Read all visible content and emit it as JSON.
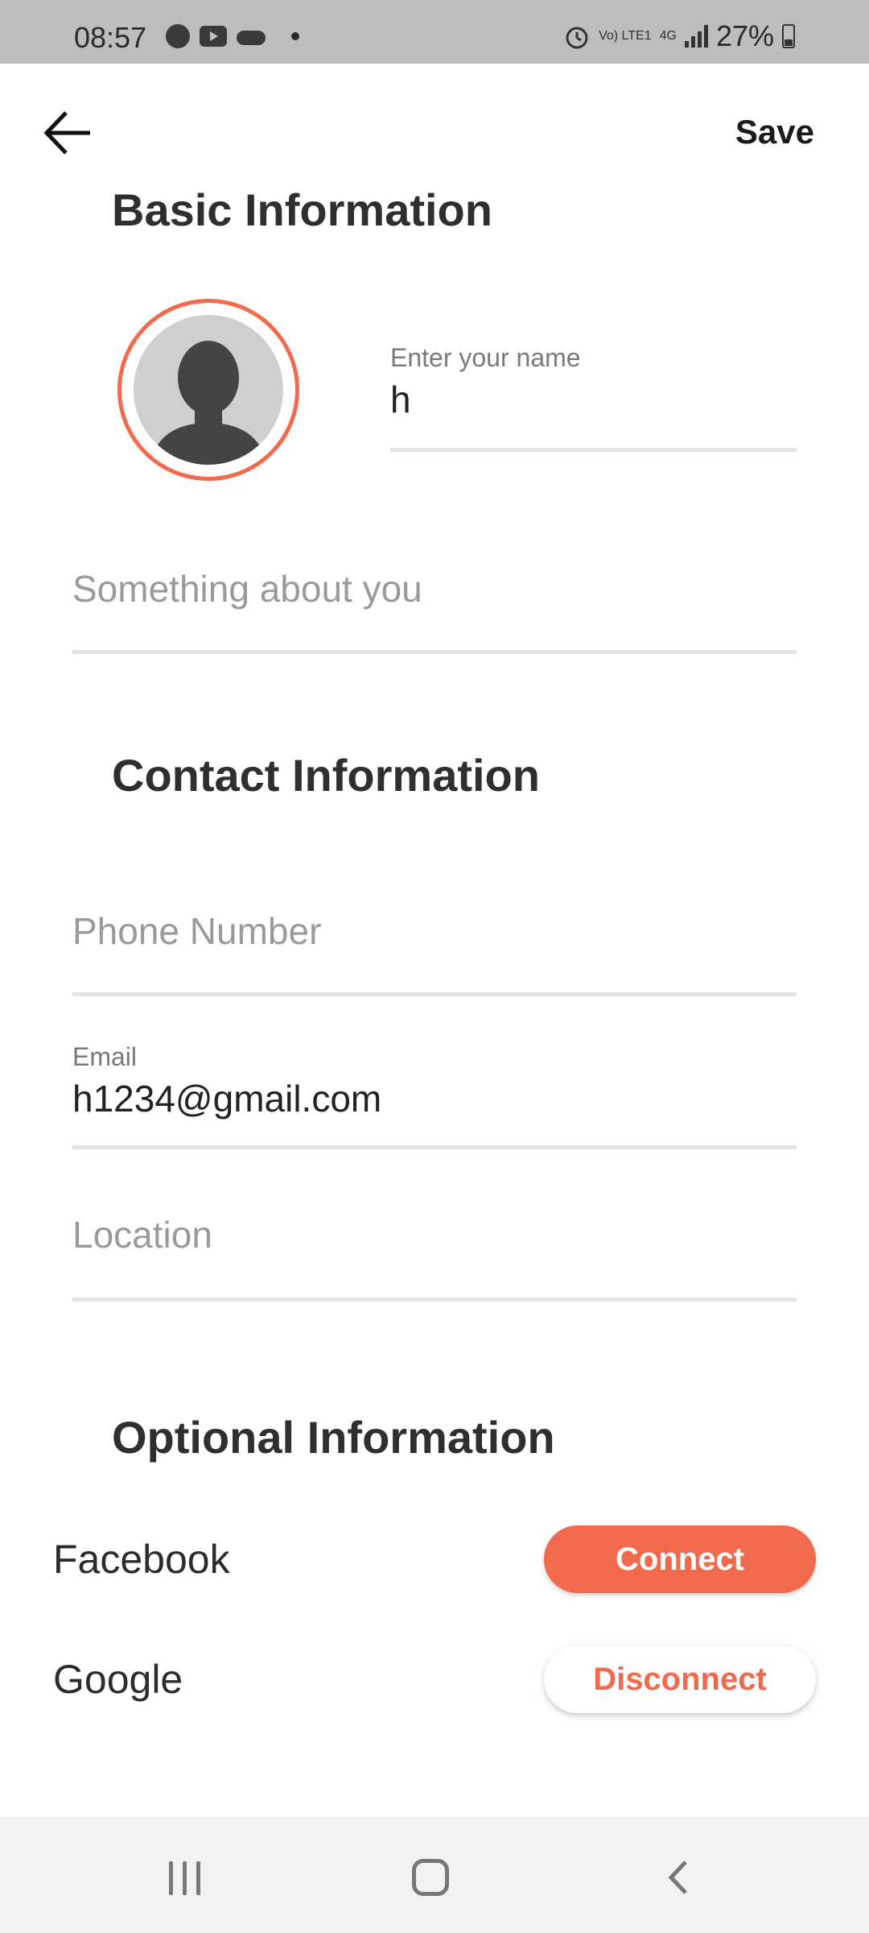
{
  "status_bar": {
    "time": "08:57",
    "battery": "27%",
    "network": "4G",
    "volte": "Vo) LTE1"
  },
  "header": {
    "back_icon": "arrow-left-icon",
    "save_label": "Save"
  },
  "basic_info": {
    "title": "Basic Information",
    "name_label": "Enter your name",
    "name_value": "h",
    "about_placeholder": "Something about you"
  },
  "contact_info": {
    "title": "Contact Information",
    "phone_placeholder": "Phone Number",
    "email_label": "Email",
    "email_value": "h1234@gmail.com",
    "location_placeholder": "Location"
  },
  "optional_info": {
    "title": "Optional Information",
    "accounts": [
      {
        "name": "Facebook",
        "action": "Connect"
      },
      {
        "name": "Google",
        "action": "Disconnect"
      }
    ]
  },
  "colors": {
    "accent": "#f26a4b",
    "status_bar": "#bdbdbd",
    "nav_bar": "#f2f2f2"
  }
}
